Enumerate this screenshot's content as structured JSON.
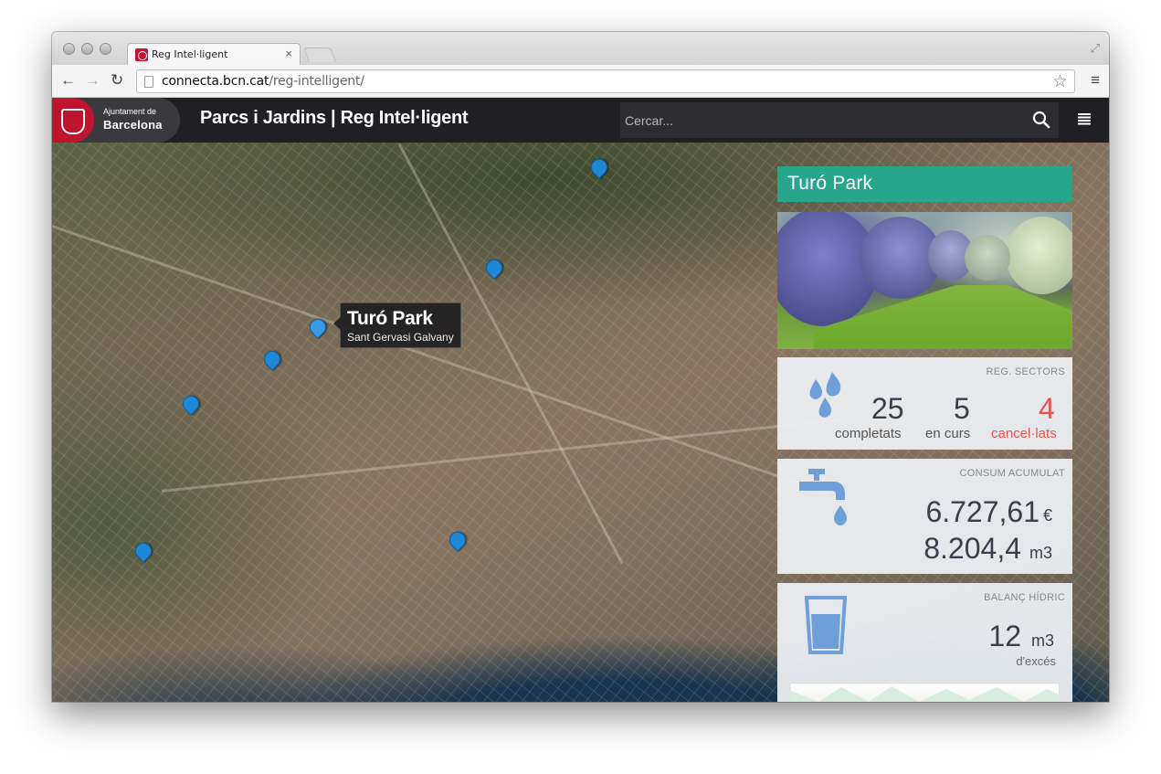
{
  "browser": {
    "tab_title": "Reg Intel·ligent",
    "tab_close": "×",
    "url_host": "connecta.bcn.cat",
    "url_path": "/reg-intelligent/",
    "back": "←",
    "forward": "→",
    "reload": "↻",
    "star": "☆",
    "menu": "≡",
    "resize": "⤢"
  },
  "header": {
    "logo_small": "Ajuntament de",
    "logo_big": "Barcelona",
    "title": "Parcs i Jardins | Reg Intel·ligent",
    "search_placeholder": "Cercar..."
  },
  "map": {
    "tooltip": {
      "title": "Turó Park",
      "subtitle": "Sant Gervasi Galvany"
    }
  },
  "panel": {
    "park_name": "Turó Park",
    "reg_sectors": {
      "label": "REG. SECTORS",
      "completed": {
        "value": "25",
        "caption": "completats"
      },
      "in_progress": {
        "value": "5",
        "caption": "en curs"
      },
      "cancelled": {
        "value": "4",
        "caption": "cancel·lats"
      },
      "colors": {
        "cancelled": "#e8534a",
        "icon": "#6f9fd8"
      }
    },
    "consum": {
      "label": "CONSUM ACUMULAT",
      "cost_value": "6.727,61",
      "cost_unit": "€",
      "volume_value": "8.204,4",
      "volume_unit": "m3"
    },
    "balanc": {
      "label": "BALANÇ HÍDRIC",
      "value": "12",
      "unit": "m3",
      "sub": "d'excés"
    }
  },
  "colors": {
    "accent": "#26a68a",
    "brand_red": "#c0142e",
    "pin": "#1e88d6"
  }
}
